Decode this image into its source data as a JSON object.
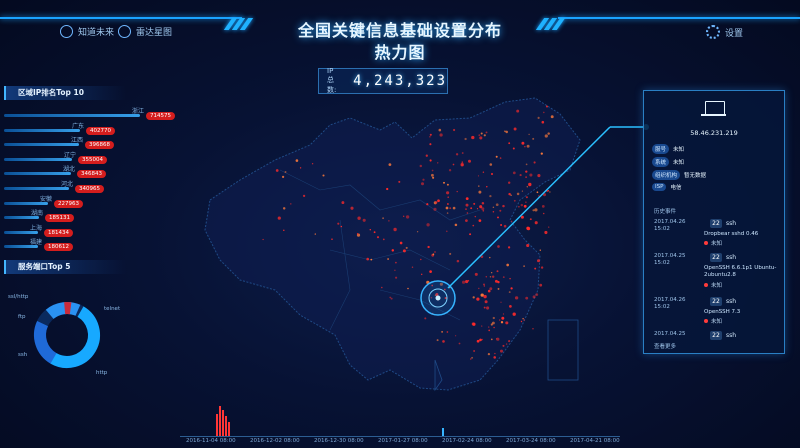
{
  "app": {
    "title_line1": "全国关键信息基础设置分布",
    "title_line2": "热力图",
    "nav_left": [
      {
        "label": "知道未来",
        "icon": "shield-icon"
      },
      {
        "label": "雷达星图",
        "icon": "radar-icon"
      }
    ],
    "settings_label": "设置",
    "settings_icon": "gear-icon"
  },
  "ip_total": {
    "label": "IP 总数:",
    "value": "4,243,323"
  },
  "top10": {
    "title": "区域IP排名Top 10",
    "items": [
      {
        "region": "浙江",
        "value": "714575",
        "fraction": 1.0
      },
      {
        "region": "广东",
        "value": "402770",
        "fraction": 0.56
      },
      {
        "region": "江西",
        "value": "396868",
        "fraction": 0.55
      },
      {
        "region": "辽宁",
        "value": "355004",
        "fraction": 0.5
      },
      {
        "region": "湖北",
        "value": "346843",
        "fraction": 0.49
      },
      {
        "region": "河北",
        "value": "340965",
        "fraction": 0.48
      },
      {
        "region": "安徽",
        "value": "227963",
        "fraction": 0.32
      },
      {
        "region": "湖南",
        "value": "185131",
        "fraction": 0.26
      },
      {
        "region": "上海",
        "value": "181434",
        "fraction": 0.25
      },
      {
        "region": "福建",
        "value": "180612",
        "fraction": 0.25
      }
    ]
  },
  "ports": {
    "title": "服务端口Top 5",
    "labels": [
      "ssl/http",
      "ftp",
      "ssh",
      "telnet",
      "http"
    ]
  },
  "detail": {
    "ip": "58.46.231.219",
    "fields": [
      {
        "key": "服号",
        "value": "未知"
      },
      {
        "key": "系统",
        "value": "未知"
      },
      {
        "key": "组织机构",
        "value": "暂无数据"
      },
      {
        "key": "ISP",
        "value": "电信"
      }
    ],
    "history_title": "历史事件",
    "history": [
      {
        "date": "2017.04.26",
        "time": "15:02",
        "port": "22",
        "proto": "ssh",
        "software": "Dropbear sshd 0.46",
        "status": "未知"
      },
      {
        "date": "2017.04.25",
        "time": "15:02",
        "port": "22",
        "proto": "ssh",
        "software": "OpenSSH 6.6.1p1 Ubuntu-2ubuntu2.8",
        "status": "未知"
      },
      {
        "date": "2017.04.26",
        "time": "15:02",
        "port": "22",
        "proto": "ssh",
        "software": "OpenSSH 7.3",
        "status": "未知"
      },
      {
        "date": "2017.04.25",
        "time": "15:02",
        "port": "22",
        "proto": "ssh",
        "software": "",
        "status": ""
      }
    ],
    "more_label": "查看更多"
  },
  "timeline": {
    "labels": [
      "2016-11-04 08:00",
      "2016-12-02 08:00",
      "2016-12-30 08:00",
      "2017-01-27 08:00",
      "2017-02-24 08:00",
      "2017-03-24 08:00",
      "2017-04-21 08:00"
    ]
  },
  "colors": {
    "accent": "#1aa3ff",
    "badge_red": "#d41d1d",
    "panel_bg": "#06163a"
  }
}
